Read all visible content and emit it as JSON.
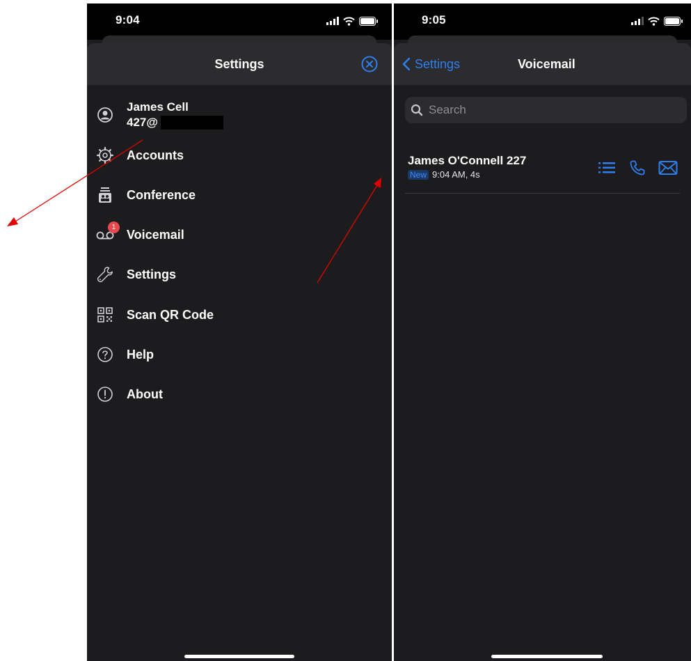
{
  "left_screen": {
    "status_time": "9:04",
    "title": "Settings",
    "account": {
      "name": "James Cell",
      "id": "427@"
    },
    "menu": [
      {
        "label": "Accounts",
        "icon": "gear-icon"
      },
      {
        "label": "Conference",
        "icon": "conference-icon"
      },
      {
        "label": "Voicemail",
        "icon": "voicemail-icon",
        "badge": "1"
      },
      {
        "label": "Settings",
        "icon": "wrench-icon"
      },
      {
        "label": "Scan QR Code",
        "icon": "qr-code-icon"
      },
      {
        "label": "Help",
        "icon": "help-icon"
      },
      {
        "label": "About",
        "icon": "info-icon"
      }
    ]
  },
  "right_screen": {
    "status_time": "9:05",
    "back_label": "Settings",
    "title": "Voicemail",
    "search_placeholder": "Search",
    "voicemail": {
      "name": "James O'Connell 227",
      "badge": "New",
      "meta": "9:04 AM, 4s"
    }
  },
  "colors": {
    "accent": "#2f7ff0",
    "background": "#1c1c1e",
    "badge": "#e5484d",
    "annotation": "#e00000"
  }
}
